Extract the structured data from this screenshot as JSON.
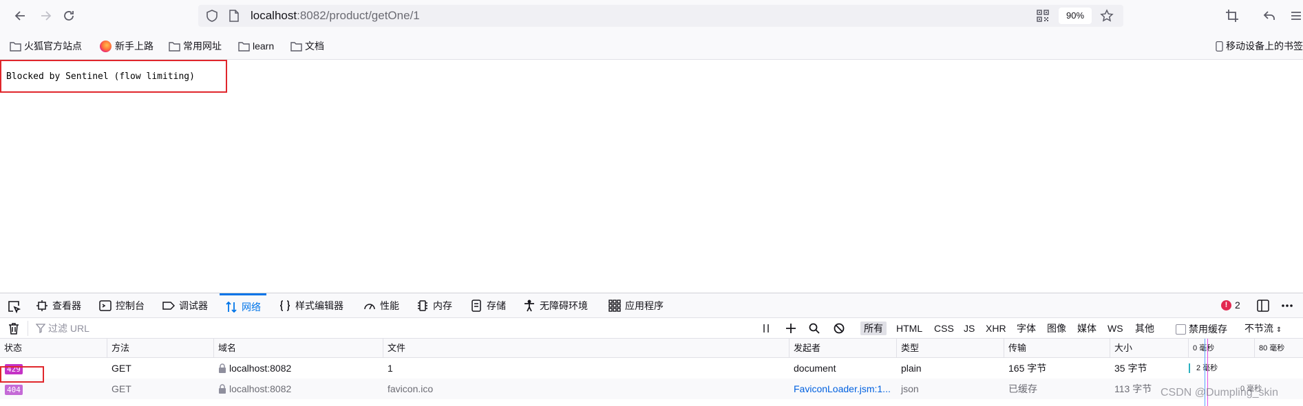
{
  "toolbar": {
    "url_host": "localhost",
    "url_rest": ":8082/product/getOne/1",
    "zoom": "90%"
  },
  "bookmarks": [
    {
      "label": "火狐官方站点",
      "icon": "folder-icon"
    },
    {
      "label": "新手上路",
      "icon": "firefox-icon"
    },
    {
      "label": "常用网址",
      "icon": "folder-icon"
    },
    {
      "label": "learn",
      "icon": "folder-icon"
    },
    {
      "label": "文档",
      "icon": "folder-icon"
    }
  ],
  "mobile_bookmarks": "移动设备上的书签",
  "page": {
    "message": "Blocked by Sentinel (flow limiting)"
  },
  "devtools": {
    "tabs": [
      {
        "label": "查看器",
        "icon": "inspector-icon"
      },
      {
        "label": "控制台",
        "icon": "console-icon"
      },
      {
        "label": "调试器",
        "icon": "debugger-icon"
      },
      {
        "label": "网络",
        "icon": "network-icon",
        "active": true
      },
      {
        "label": "样式编辑器",
        "icon": "style-editor-icon"
      },
      {
        "label": "性能",
        "icon": "performance-icon"
      },
      {
        "label": "内存",
        "icon": "memory-icon"
      },
      {
        "label": "存储",
        "icon": "storage-icon"
      },
      {
        "label": "无障碍环境",
        "icon": "accessibility-icon"
      },
      {
        "label": "应用程序",
        "icon": "application-icon"
      }
    ],
    "error_count": "2",
    "filter_placeholder": "过滤 URL",
    "type_filters": [
      "所有",
      "HTML",
      "CSS",
      "JS",
      "XHR",
      "字体",
      "图像",
      "媒体",
      "WS",
      "其他"
    ],
    "disable_cache_label": "禁用缓存",
    "throttle_label": "不节流",
    "columns": [
      "状态",
      "方法",
      "域名",
      "文件",
      "发起者",
      "类型",
      "传输",
      "大小"
    ],
    "timeline_ticks": [
      "0 毫秒",
      "80 毫秒"
    ],
    "rows": [
      {
        "status": "429",
        "status_color": "#c433c6",
        "method": "GET",
        "domain": "localhost:8082",
        "file": "1",
        "initiator": "document",
        "type": "plain",
        "transferred": "165 字节",
        "size": "35 字节",
        "timing": "2 毫秒"
      },
      {
        "status": "404",
        "status_color": "#c46ad6",
        "method": "GET",
        "domain": "localhost:8082",
        "file": "favicon.ico",
        "initiator": "FaviconLoader.jsm:1...",
        "type": "json",
        "transferred": "已缓存",
        "size": "113 字节",
        "timing": "0 毫秒"
      }
    ]
  },
  "watermark": "CSDN @Dumpling_skin",
  "colors": {
    "highlight_box": "#e0262b",
    "accent": "#0074e8"
  }
}
